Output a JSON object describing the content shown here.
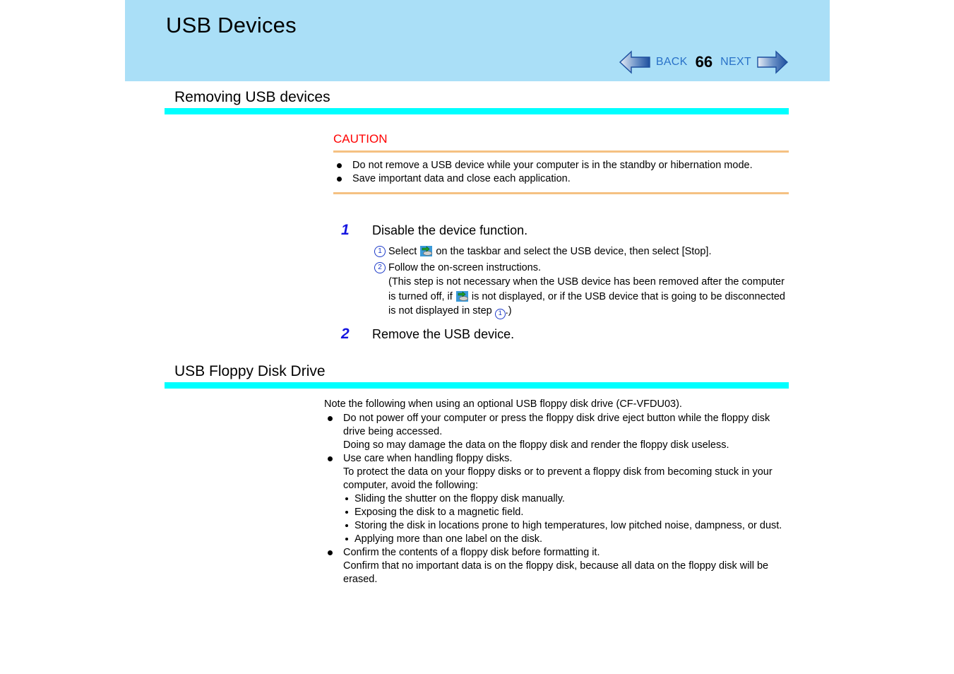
{
  "header": {
    "title": "USB Devices",
    "nav": {
      "back_label": "BACK",
      "page_number": "66",
      "next_label": "NEXT",
      "back_arrow_icon": "arrow-left-icon",
      "next_arrow_icon": "arrow-right-icon"
    },
    "banner_color": "#aadff7",
    "link_color": "#2a72c8"
  },
  "sections": [
    {
      "heading": "Removing USB devices",
      "rule_color": "#00ffff"
    },
    {
      "heading": "USB Floppy Disk Drive",
      "rule_color": "#00ffff"
    }
  ],
  "caution": {
    "title": "CAUTION",
    "title_color": "#ff0000",
    "rule_color": "#f5c182",
    "items": [
      "Do not remove a USB device while your computer is in the standby or hibernation mode.",
      "Save important data and close each application."
    ]
  },
  "steps": [
    {
      "number": "1",
      "title": "Disable the device function.",
      "substeps": [
        {
          "marker": "1",
          "text_before_icon": "Select ",
          "icon": "safely-remove-hardware-icon",
          "text_after_icon": " on the taskbar and select the USB device, then select [Stop]."
        },
        {
          "marker": "2",
          "text": "Follow the on-screen instructions.",
          "note_part_1": "(This step is not necessary when the USB device has been removed after the computer is turned off, if ",
          "note_icon": "safely-remove-hardware-icon",
          "note_part_2": " is not displayed, or if the USB device that is going to be disconnected is not displayed in step ",
          "note_ref_marker": "1",
          "note_part_3": ".)"
        }
      ]
    },
    {
      "number": "2",
      "title": "Remove the USB device."
    }
  ],
  "floppy": {
    "intro": "Note the following when using an optional USB floppy disk drive (CF-VFDU03).",
    "bullets": [
      {
        "text": "Do not power off your computer or press the floppy disk drive eject button while the floppy disk drive being accessed.",
        "continuation": "Doing so may damage the data on the floppy disk and render the floppy disk useless."
      },
      {
        "text": "Use care when handling floppy disks.",
        "continuation": "To protect the data on your floppy disks or to prevent a floppy disk from becoming stuck in your computer, avoid the following:",
        "subbullets": [
          "Sliding the shutter on the floppy disk manually.",
          "Exposing the disk to a magnetic field.",
          "Storing the disk in locations prone to high temperatures, low pitched noise, dampness, or dust.",
          "Applying more than one label on the disk."
        ]
      },
      {
        "text": "Confirm the contents of a floppy disk before formatting it.",
        "continuation": "Confirm that no important data is on the floppy disk, because all data on the floppy disk will be erased."
      }
    ]
  }
}
